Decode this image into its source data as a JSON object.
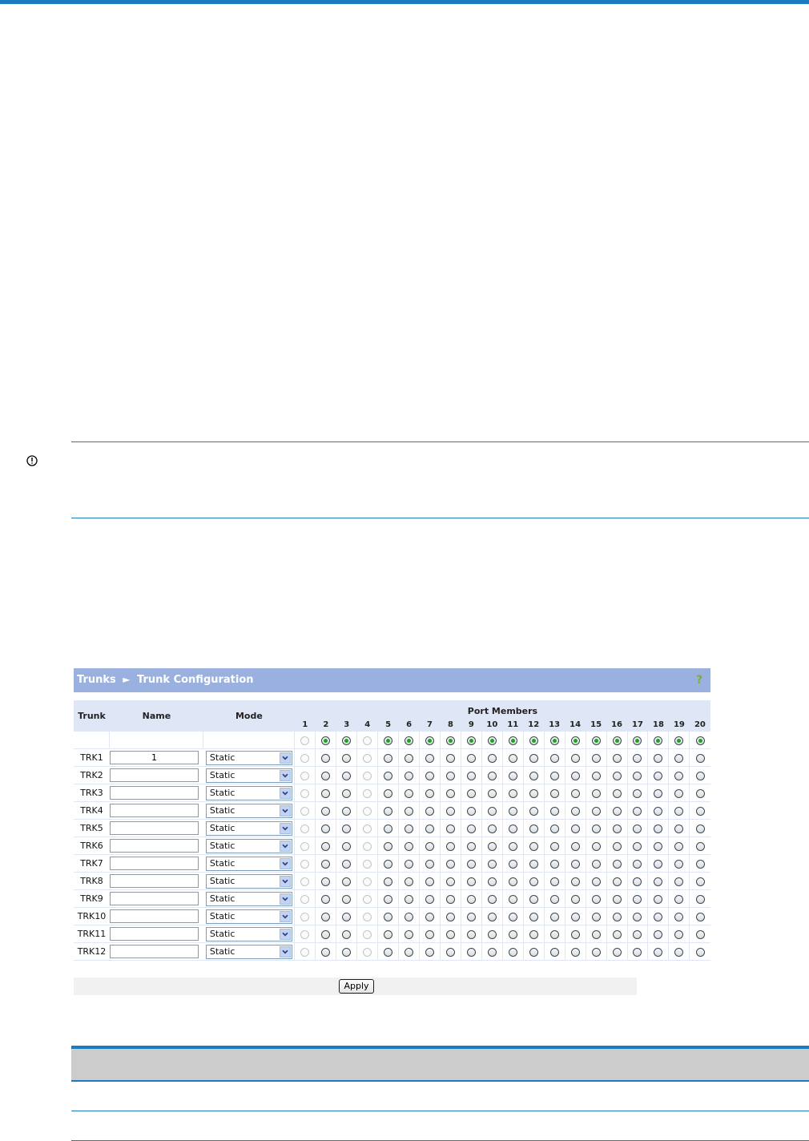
{
  "breadcrumb": {
    "section": "Trunks",
    "separator": "►",
    "page": "Trunk Configuration"
  },
  "table_headers": {
    "trunk": "Trunk",
    "name": "Name",
    "mode": "Mode",
    "port_members": "Port Members"
  },
  "ports": [
    "1",
    "2",
    "3",
    "4",
    "5",
    "6",
    "7",
    "8",
    "9",
    "10",
    "11",
    "12",
    "13",
    "14",
    "15",
    "16",
    "17",
    "18",
    "19",
    "20"
  ],
  "disabled_ports": [
    "1",
    "4"
  ],
  "select_all_row_checked": [
    "2",
    "3",
    "5",
    "6",
    "7",
    "8",
    "9",
    "10",
    "11",
    "12",
    "13",
    "14",
    "15",
    "16",
    "17",
    "18",
    "19",
    "20"
  ],
  "trunks": [
    {
      "id": "TRK1",
      "name": "1",
      "mode": "Static"
    },
    {
      "id": "TRK2",
      "name": "",
      "mode": "Static"
    },
    {
      "id": "TRK3",
      "name": "",
      "mode": "Static"
    },
    {
      "id": "TRK4",
      "name": "",
      "mode": "Static"
    },
    {
      "id": "TRK5",
      "name": "",
      "mode": "Static"
    },
    {
      "id": "TRK6",
      "name": "",
      "mode": "Static"
    },
    {
      "id": "TRK7",
      "name": "",
      "mode": "Static"
    },
    {
      "id": "TRK8",
      "name": "",
      "mode": "Static"
    },
    {
      "id": "TRK9",
      "name": "",
      "mode": "Static"
    },
    {
      "id": "TRK10",
      "name": "",
      "mode": "Static"
    },
    {
      "id": "TRK11",
      "name": "",
      "mode": "Static"
    },
    {
      "id": "TRK12",
      "name": "",
      "mode": "Static"
    }
  ],
  "apply_label": "Apply",
  "colors": {
    "accent_rule": "#1a7bc0",
    "titlebar": "#9ab0df",
    "table_header": "#dfe7f7",
    "radio_checked": "#21a121"
  },
  "icons": {
    "important": "exclamation-circle-icon",
    "help": "question-mark-help-icon",
    "dropdown": "chevron-down-icon"
  }
}
